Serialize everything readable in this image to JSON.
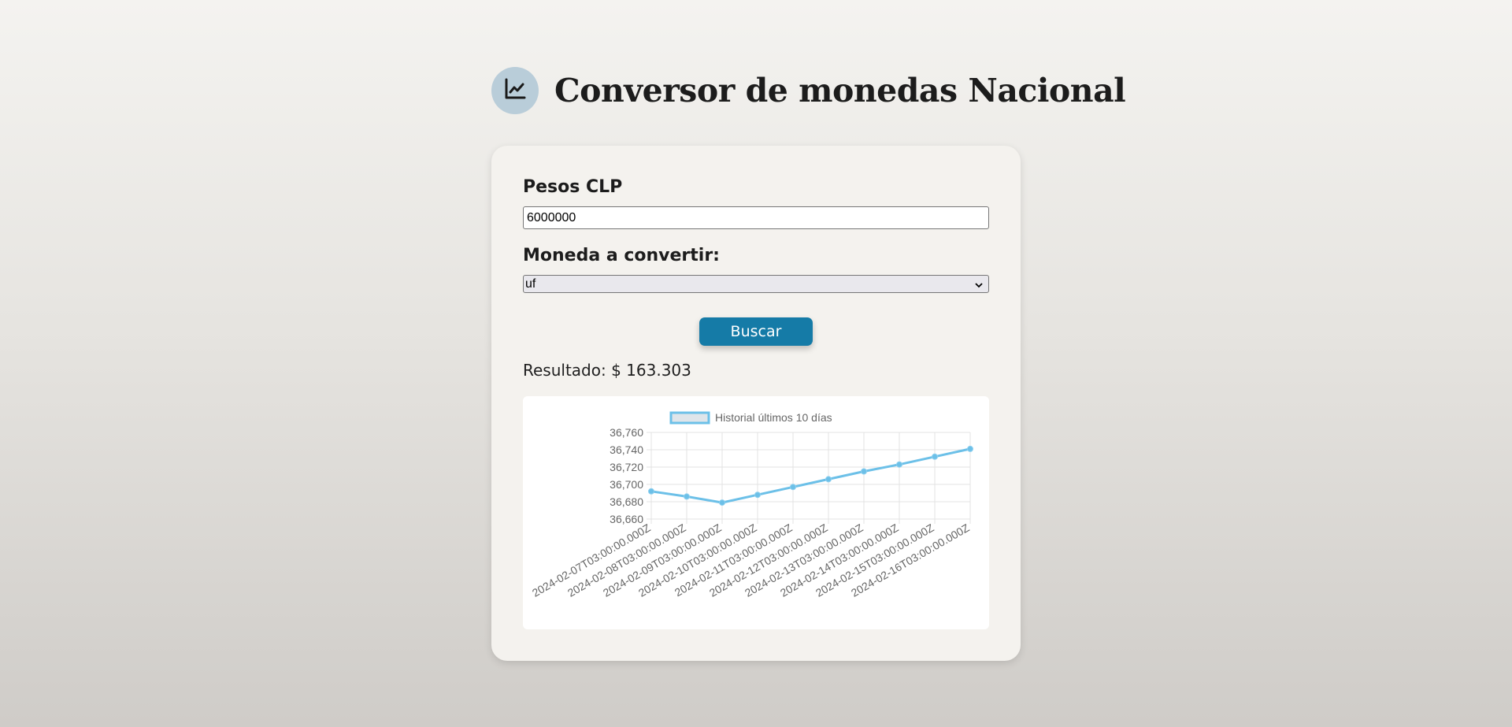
{
  "header": {
    "title": "Conversor de monedas Nacional",
    "logo_icon": "line-chart-icon"
  },
  "form": {
    "amount_label": "Pesos CLP",
    "amount_value": "6000000",
    "currency_label": "Moneda a convertir:",
    "currency_selected": "uf",
    "search_button": "Buscar"
  },
  "result": {
    "text": "Resultado: $ 163.303"
  },
  "colors": {
    "accent": "#157ba7",
    "chart_line": "#6cc0e8",
    "logo_bg": "#b9cdd9"
  },
  "chart_data": {
    "type": "line",
    "legend": "Historial últimos 10 días",
    "legend_position": "top",
    "grid": true,
    "x": [
      "2024-02-07T03:00:00.000Z",
      "2024-02-08T03:00:00.000Z",
      "2024-02-09T03:00:00.000Z",
      "2024-02-10T03:00:00.000Z",
      "2024-02-11T03:00:00.000Z",
      "2024-02-12T03:00:00.000Z",
      "2024-02-13T03:00:00.000Z",
      "2024-02-14T03:00:00.000Z",
      "2024-02-15T03:00:00.000Z",
      "2024-02-16T03:00:00.000Z"
    ],
    "series": [
      {
        "name": "Historial últimos 10 días",
        "values": [
          36692,
          36686,
          36679,
          36688,
          36697,
          36706,
          36715,
          36723,
          36732,
          36741
        ]
      }
    ],
    "yticks": [
      "36,760",
      "36,740",
      "36,720",
      "36,700",
      "36,680",
      "36,660"
    ],
    "ylim": [
      36660,
      36760
    ]
  }
}
